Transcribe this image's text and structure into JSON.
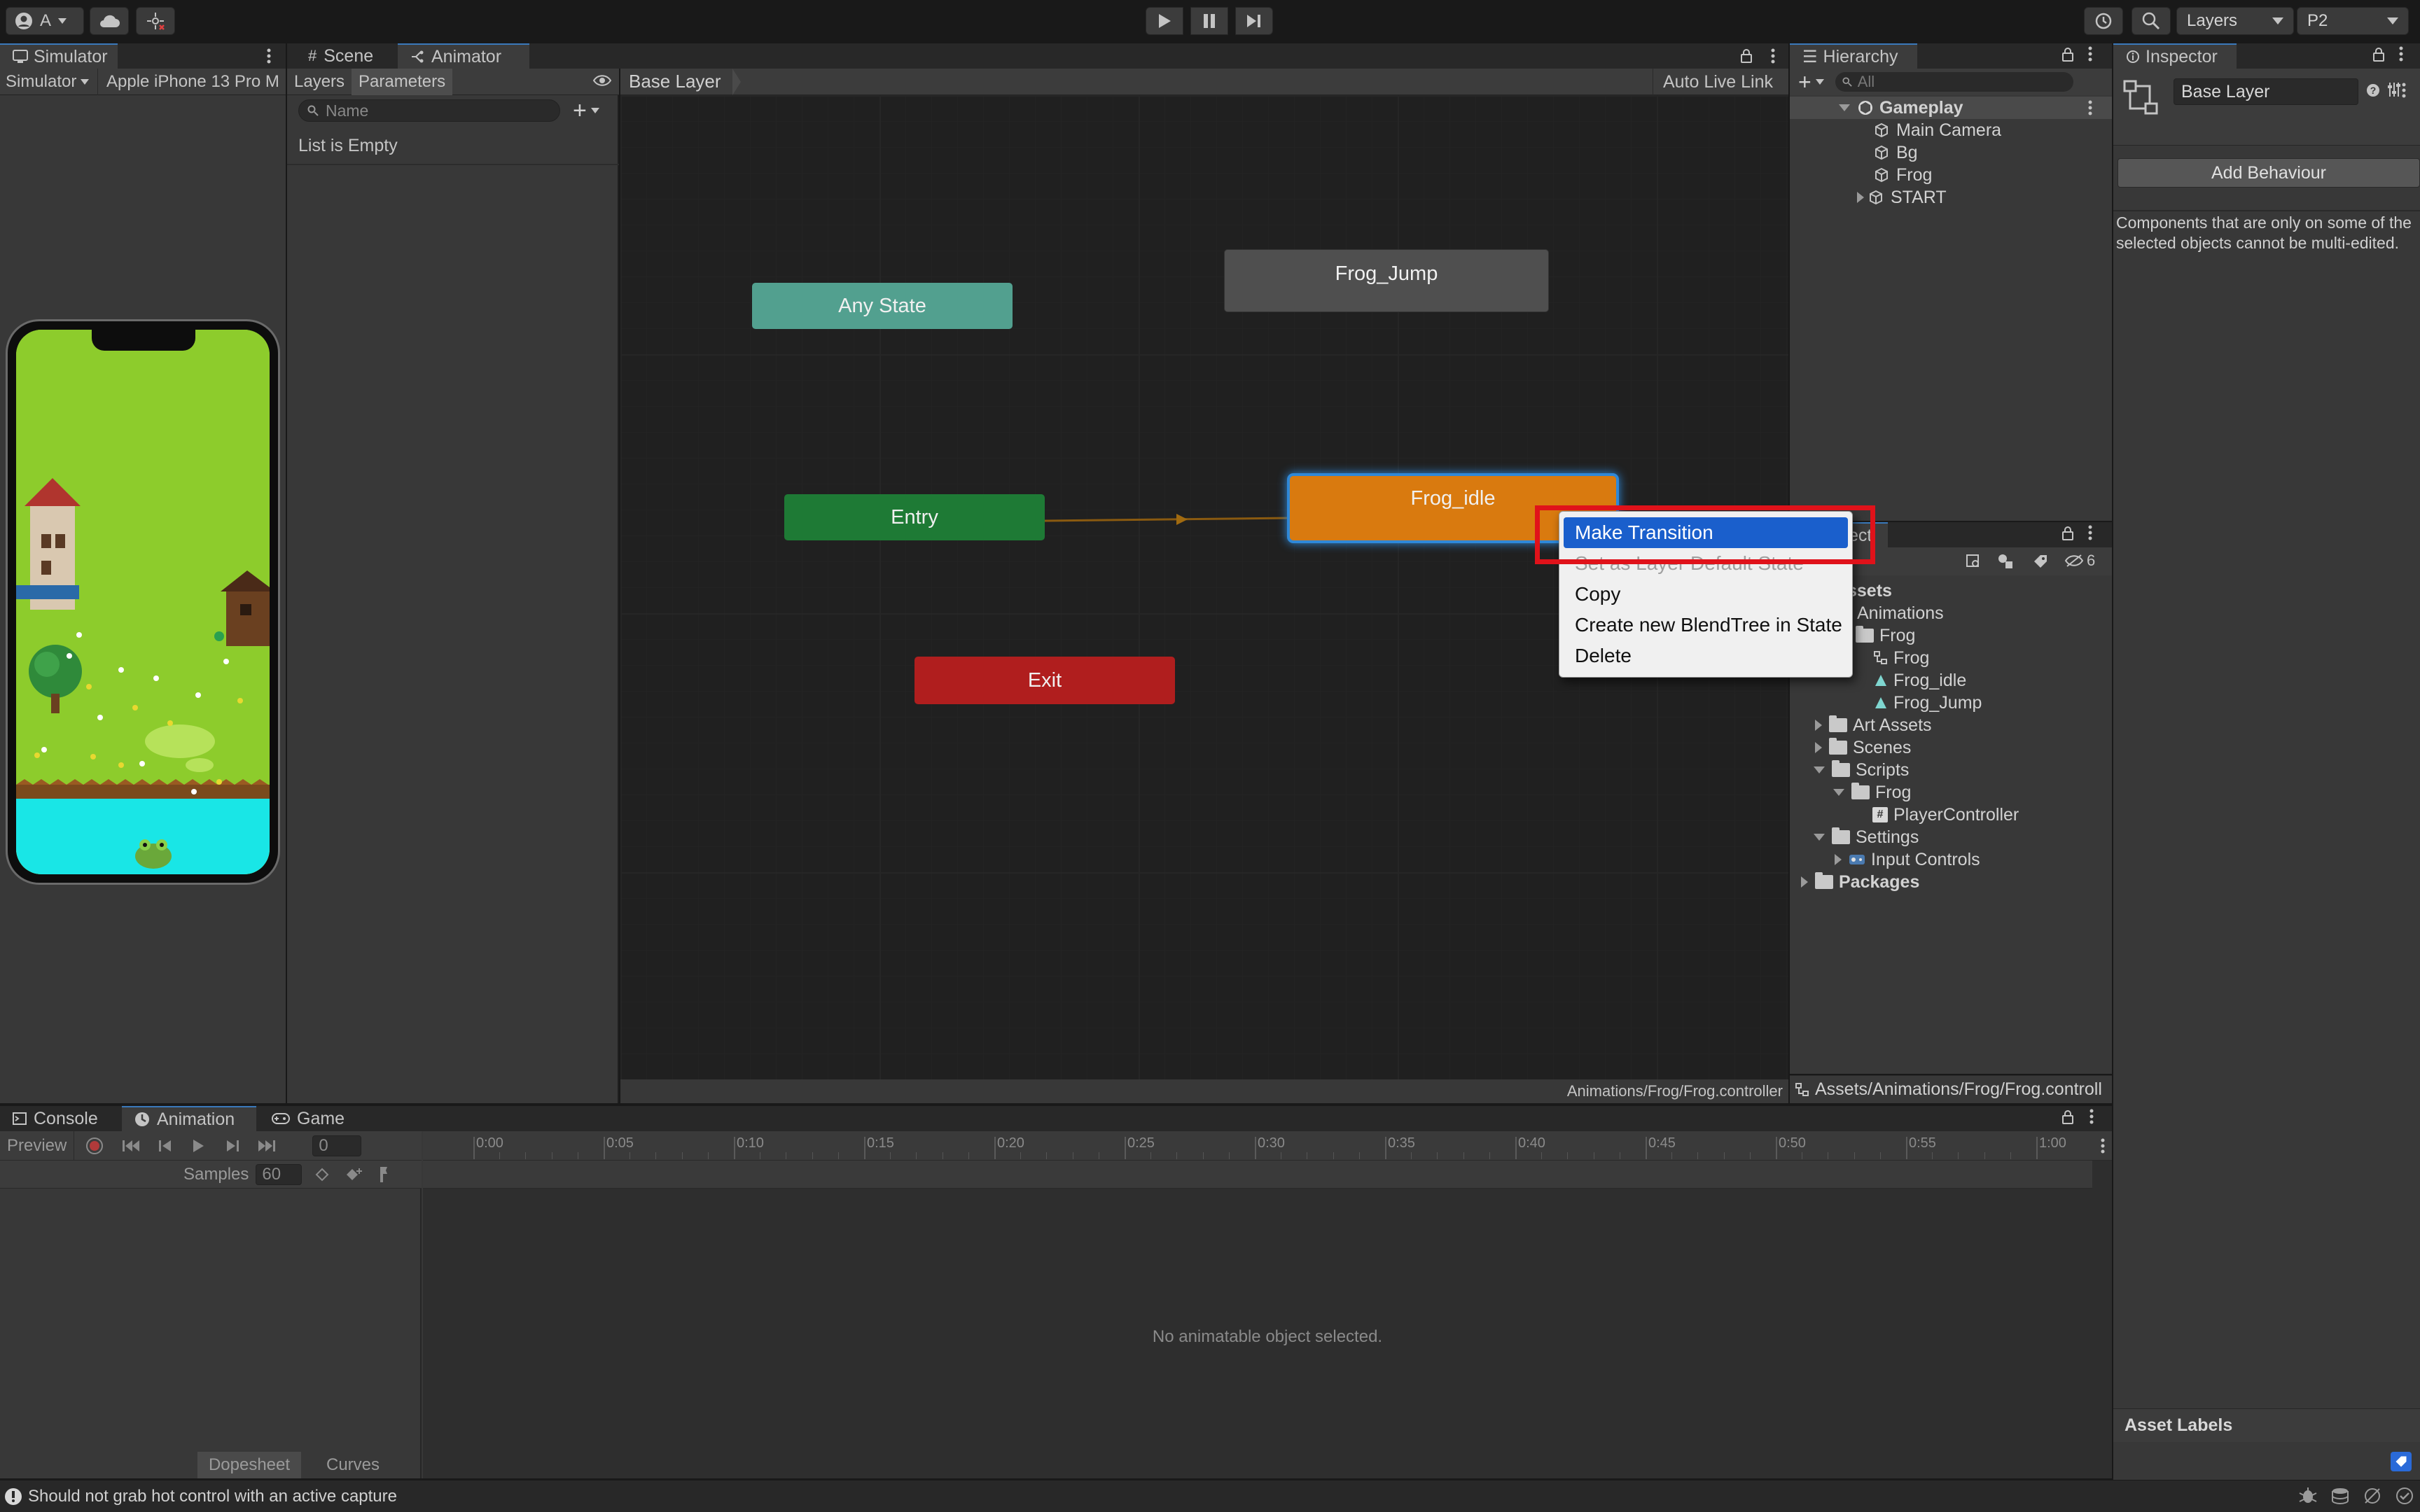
{
  "toolbar": {
    "account_label": "A",
    "layers_label": "Layers",
    "layout_label": "P2"
  },
  "simulator": {
    "tab_label": "Simulator",
    "mode_label": "Simulator",
    "device_label": "Apple iPhone 13 Pro M"
  },
  "animator": {
    "tabs": [
      "Scene",
      "Animator"
    ],
    "side_tabs": [
      "Layers",
      "Parameters"
    ],
    "search_placeholder": "Name",
    "list_empty": "List is Empty",
    "breadcrumb": "Base Layer",
    "auto_live_link": "Auto Live Link",
    "footer_path": "Animations/Frog/Frog.controller",
    "nodes": {
      "any_state": "Any State",
      "frog_jump": "Frog_Jump",
      "entry": "Entry",
      "frog_idle": "Frog_idle",
      "exit": "Exit"
    },
    "colors": {
      "any_state": "#52a08f",
      "frog_jump": "#4f4f4f",
      "entry": "#1e7a35",
      "frog_idle": "#d97a0f",
      "exit": "#b01e1e",
      "highlight": "#e0121a"
    }
  },
  "context_menu": {
    "items": [
      "Make Transition",
      "Set as Layer Default State",
      "Copy",
      "Create new BlendTree in State",
      "Delete"
    ]
  },
  "hierarchy": {
    "tab_label": "Hierarchy",
    "search_placeholder": "All",
    "scene": "Gameplay",
    "items": [
      "Main Camera",
      "Bg",
      "Frog",
      "START"
    ]
  },
  "project": {
    "tab_label": "ect",
    "hidden_count": "6",
    "items": {
      "assets": "ssets",
      "animations": "Animations",
      "frog_folder": "Frog",
      "frog_controller": "Frog",
      "frog_idle": "Frog_idle",
      "frog_jump": "Frog_Jump",
      "art_assets": "Art Assets",
      "scenes": "Scenes",
      "scripts": "Scripts",
      "scripts_frog": "Frog",
      "player_controller": "PlayerController",
      "settings": "Settings",
      "input_controls": "Input Controls",
      "packages": "Packages"
    },
    "footer_path": "Assets/Animations/Frog/Frog.controll"
  },
  "inspector": {
    "tab_label": "Inspector",
    "object_name": "Base Layer",
    "add_behaviour": "Add Behaviour",
    "message": "Components that are only on some of the selected objects cannot be multi-edited.",
    "asset_labels": "Asset Labels"
  },
  "animation_panel": {
    "tabs": [
      "Console",
      "Animation",
      "Game"
    ],
    "preview_label": "Preview",
    "frame_value": "0",
    "samples_label": "Samples",
    "samples_value": "60",
    "timeline_ticks": [
      "0:00",
      "0:05",
      "0:10",
      "0:15",
      "0:20",
      "0:25",
      "0:30",
      "0:35",
      "0:40",
      "0:45",
      "0:50",
      "0:55",
      "1:00"
    ],
    "empty_message": "No animatable object selected.",
    "dopesheet": "Dopesheet",
    "curves": "Curves"
  },
  "status_bar": {
    "message": "Should not grab hot control with an active capture"
  }
}
